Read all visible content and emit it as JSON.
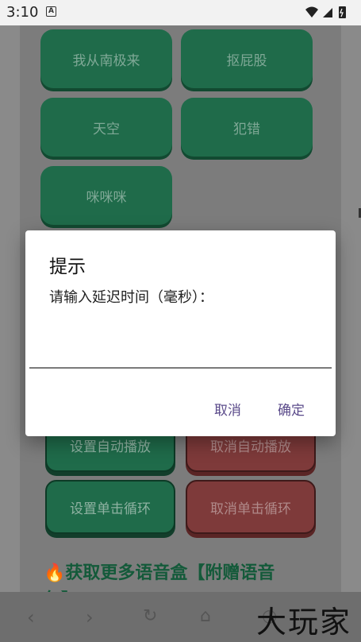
{
  "status_bar": {
    "time": "3:10",
    "badge": "A"
  },
  "grid_buttons": [
    {
      "label": "我从南极来"
    },
    {
      "label": "抠屁股"
    },
    {
      "label": "天空"
    },
    {
      "label": "犯错"
    },
    {
      "label": "咪咪咪"
    }
  ],
  "controls": {
    "set_autoplay": "设置自动播放",
    "cancel_autoplay": "取消自动播放",
    "set_click_loop": "设置单击循环",
    "cancel_click_loop": "取消单击循环"
  },
  "promo": {
    "icon": "fire-icon",
    "text": "获取更多语音盒【附赠语音",
    "text_line2": "包】"
  },
  "dialog": {
    "title": "提示",
    "message": "请输入延迟时间（毫秒）：",
    "input_value": "",
    "cancel_label": "取消",
    "confirm_label": "确定"
  },
  "bottom_nav": [
    "back-icon",
    "forward-icon",
    "refresh-icon",
    "home-icon",
    "history-icon"
  ],
  "watermark": "大玩家",
  "colors": {
    "green": "#1f6b4a",
    "red": "#7e3a3a",
    "accent": "#5a4a8a"
  }
}
